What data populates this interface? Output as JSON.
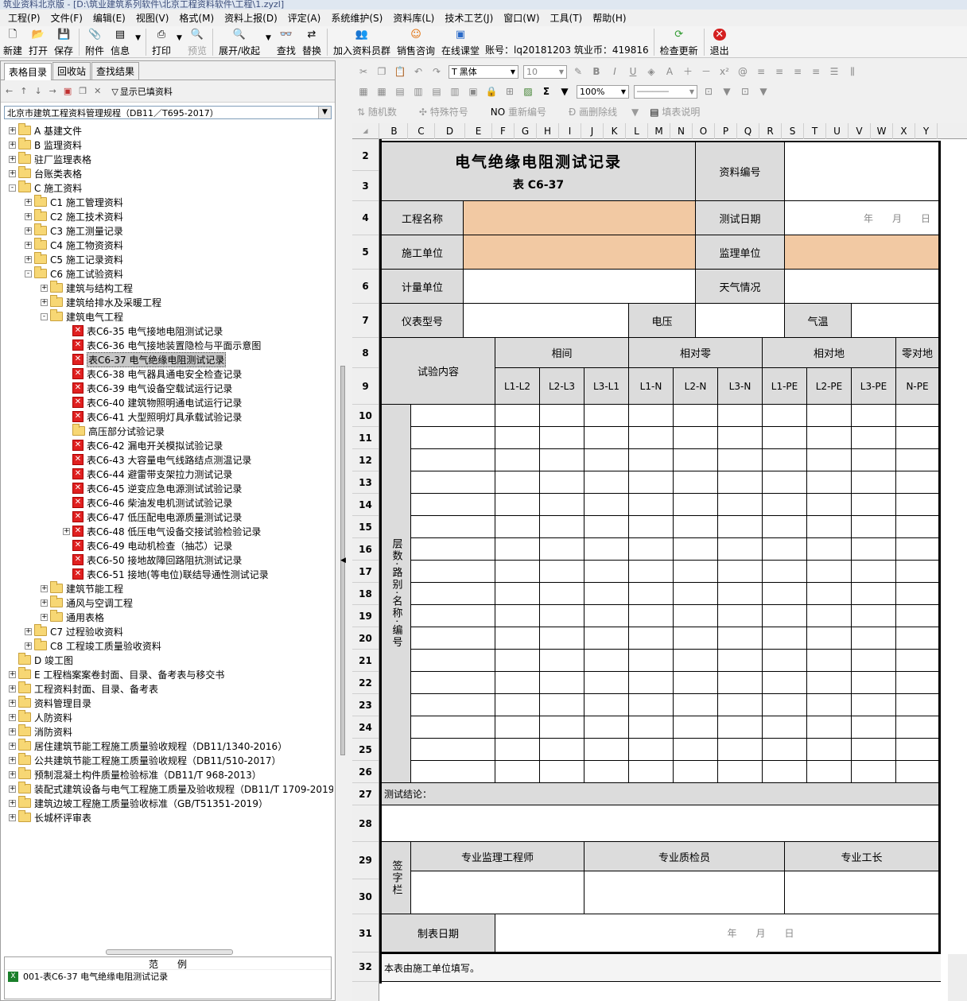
{
  "window": {
    "title": "筑业资料北京版 - [D:\\筑业建筑系列软件\\北京工程资料软件\\工程\\1.zyzl]"
  },
  "menu": [
    "工程(P)",
    "文件(F)",
    "编辑(E)",
    "视图(V)",
    "格式(M)",
    "资料上报(D)",
    "评定(A)",
    "系统维护(S)",
    "资料库(L)",
    "技术工艺(J)",
    "窗口(W)",
    "工具(T)",
    "帮助(H)"
  ],
  "toolbar": {
    "new": "新建",
    "open": "打开",
    "save": "保存",
    "attach": "附件",
    "info": "信息",
    "print": "打印",
    "preview": "预览",
    "expand": "展开/收起",
    "find": "查找",
    "replace": "替换",
    "join": "加入资料员群",
    "sales": "销售咨询",
    "classroom": "在线课堂",
    "account": "账号：lq20181203 筑业币：419816",
    "update": "检查更新",
    "exit": "退出"
  },
  "left": {
    "tabs": [
      "表格目录",
      "回收站",
      "查找结果"
    ],
    "show_filled": "显示已填资料",
    "combo": "北京市建筑工程资料管理规程（DB11／T695-2017）",
    "tree": [
      {
        "label": "A 基建文件",
        "level": 0,
        "exp": "+"
      },
      {
        "label": "B 监理资料",
        "level": 0,
        "exp": "+"
      },
      {
        "label": "驻厂监理表格",
        "level": 0,
        "exp": "+"
      },
      {
        "label": "台账类表格",
        "level": 0,
        "exp": "+"
      },
      {
        "label": "C 施工资料",
        "level": 0,
        "exp": "-",
        "open": true
      },
      {
        "label": "C1 施工管理资料",
        "level": 1,
        "exp": "+"
      },
      {
        "label": "C2 施工技术资料",
        "level": 1,
        "exp": "+"
      },
      {
        "label": "C3 施工测量记录",
        "level": 1,
        "exp": "+"
      },
      {
        "label": "C4 施工物资资料",
        "level": 1,
        "exp": "+"
      },
      {
        "label": "C5 施工记录资料",
        "level": 1,
        "exp": "+"
      },
      {
        "label": "C6 施工试验资料",
        "level": 1,
        "exp": "-",
        "open": true
      },
      {
        "label": "建筑与结构工程",
        "level": 2,
        "exp": "+"
      },
      {
        "label": "建筑给排水及采暖工程",
        "level": 2,
        "exp": "+"
      },
      {
        "label": "建筑电气工程",
        "level": 2,
        "exp": "-",
        "open": true
      },
      {
        "label": "表C6-35 电气接地电阻测试记录",
        "level": 3,
        "type": "form"
      },
      {
        "label": "表C6-36 电气接地装置隐检与平面示意图",
        "level": 3,
        "type": "form"
      },
      {
        "label": "表C6-37 电气绝缘电阻测试记录",
        "level": 3,
        "type": "form",
        "selected": true
      },
      {
        "label": "表C6-38 电气器具通电安全检查记录",
        "level": 3,
        "type": "form"
      },
      {
        "label": "表C6-39 电气设备空载试运行记录",
        "level": 3,
        "type": "form"
      },
      {
        "label": "表C6-40 建筑物照明通电试运行记录",
        "level": 3,
        "type": "form"
      },
      {
        "label": "表C6-41 大型照明灯具承载试验记录",
        "level": 3,
        "type": "form"
      },
      {
        "label": "高压部分试验记录",
        "level": 3,
        "type": "folder"
      },
      {
        "label": "表C6-42 漏电开关模拟试验记录",
        "level": 3,
        "type": "form"
      },
      {
        "label": "表C6-43 大容量电气线路结点测温记录",
        "level": 3,
        "type": "form"
      },
      {
        "label": "表C6-44 避雷带支架拉力测试记录",
        "level": 3,
        "type": "form"
      },
      {
        "label": "表C6-45 逆变应急电源测试试验记录",
        "level": 3,
        "type": "form"
      },
      {
        "label": "表C6-46 柴油发电机测试试验记录",
        "level": 3,
        "type": "form"
      },
      {
        "label": "表C6-47 低压配电电源质量测试记录",
        "level": 3,
        "type": "form"
      },
      {
        "label": "表C6-48 低压电气设备交接试验检验记录",
        "level": 3,
        "type": "form",
        "exp": "+"
      },
      {
        "label": "表C6-49 电动机检查（抽芯）记录",
        "level": 3,
        "type": "form"
      },
      {
        "label": "表C6-50 接地故障回路阻抗测试记录",
        "level": 3,
        "type": "form"
      },
      {
        "label": "表C6-51 接地(等电位)联结导通性测试记录",
        "level": 3,
        "type": "form"
      },
      {
        "label": "建筑节能工程",
        "level": 2,
        "exp": "+"
      },
      {
        "label": "通风与空调工程",
        "level": 2,
        "exp": "+"
      },
      {
        "label": "通用表格",
        "level": 2,
        "exp": "+"
      },
      {
        "label": "C7 过程验收资料",
        "level": 1,
        "exp": "+"
      },
      {
        "label": "C8 工程竣工质量验收资料",
        "level": 1,
        "exp": "+"
      },
      {
        "label": "D 竣工图",
        "level": 0,
        "exp": ""
      },
      {
        "label": "E 工程档案案卷封面、目录、备考表与移交书",
        "level": 0,
        "exp": "+"
      },
      {
        "label": "工程资料封面、目录、备考表",
        "level": 0,
        "exp": "+"
      },
      {
        "label": "资料管理目录",
        "level": 0,
        "exp": "+"
      },
      {
        "label": "人防资料",
        "level": 0,
        "exp": "+"
      },
      {
        "label": "消防资料",
        "level": 0,
        "exp": "+"
      },
      {
        "label": "居住建筑节能工程施工质量验收规程（DB11/1340-2016）",
        "level": 0,
        "exp": "+"
      },
      {
        "label": "公共建筑节能工程施工质量验收规程（DB11/510-2017）",
        "level": 0,
        "exp": "+"
      },
      {
        "label": "预制混凝土构件质量检验标准（DB11/T 968-2013）",
        "level": 0,
        "exp": "+"
      },
      {
        "label": "装配式建筑设备与电气工程施工质量及验收规程（DB11/T 1709-2019）",
        "level": 0,
        "exp": "+"
      },
      {
        "label": "建筑边坡工程施工质量验收标准（GB/T51351-2019）",
        "level": 0,
        "exp": "+"
      },
      {
        "label": "长城杯评审表",
        "level": 0,
        "exp": "+"
      }
    ],
    "legend_title": "范　　例",
    "legend_item": "001-表C6-37 电气绝缘电阻测试记录"
  },
  "format": {
    "font": "黑体",
    "size": "10",
    "zoom": "100%",
    "random": "随机数",
    "special": "特殊符号",
    "renumber": "重新编号",
    "delline": "画删除线",
    "fillhelp": "填表说明"
  },
  "columns": [
    "B",
    "C",
    "D",
    "E",
    "F",
    "G",
    "H",
    "I",
    "J",
    "K",
    "L",
    "M",
    "N",
    "O",
    "P",
    "Q",
    "R",
    "S",
    "T",
    "U",
    "V",
    "W",
    "X",
    "Y"
  ],
  "rows": [
    "2",
    "3",
    "4",
    "5",
    "6",
    "7",
    "8",
    "9",
    "10",
    "11",
    "12",
    "13",
    "14",
    "15",
    "16",
    "17",
    "18",
    "19",
    "20",
    "21",
    "22",
    "23",
    "24",
    "25",
    "26",
    "27",
    "28",
    "29",
    "30",
    "31",
    "32"
  ],
  "form": {
    "title": "电气绝缘电阻测试记录",
    "subtitle": "表 C6-37",
    "doc_no": "资料编号",
    "project": "工程名称",
    "test_date": "测试日期",
    "date_value": "年　月　日",
    "constructor": "施工单位",
    "supervisor": "监理单位",
    "measure_unit": "计量单位",
    "weather": "天气情况",
    "instrument": "仪表型号",
    "voltage": "电压",
    "temperature": "气温",
    "test_content": "试验内容",
    "phase": "相间",
    "phase_zero": "相对零",
    "phase_ground": "相对地",
    "zero_ground": "零对地",
    "sub": [
      "L1-L2",
      "L2-L3",
      "L3-L1",
      "L1-N",
      "L2-N",
      "L3-N",
      "L1-PE",
      "L2-PE",
      "L3-PE",
      "N-PE"
    ],
    "side_label": "层数·路别·名称·编号",
    "conclusion": "测试结论：",
    "sign_label": "签字栏",
    "sign1": "专业监理工程师",
    "sign2": "专业质检员",
    "sign3": "专业工长",
    "made_date": "制表日期",
    "made_date_value": "年　　月　　日",
    "footer": "本表由施工单位填写。"
  },
  "colors": {
    "gray": "#dcdcdc",
    "orange": "#f2c9a3"
  }
}
